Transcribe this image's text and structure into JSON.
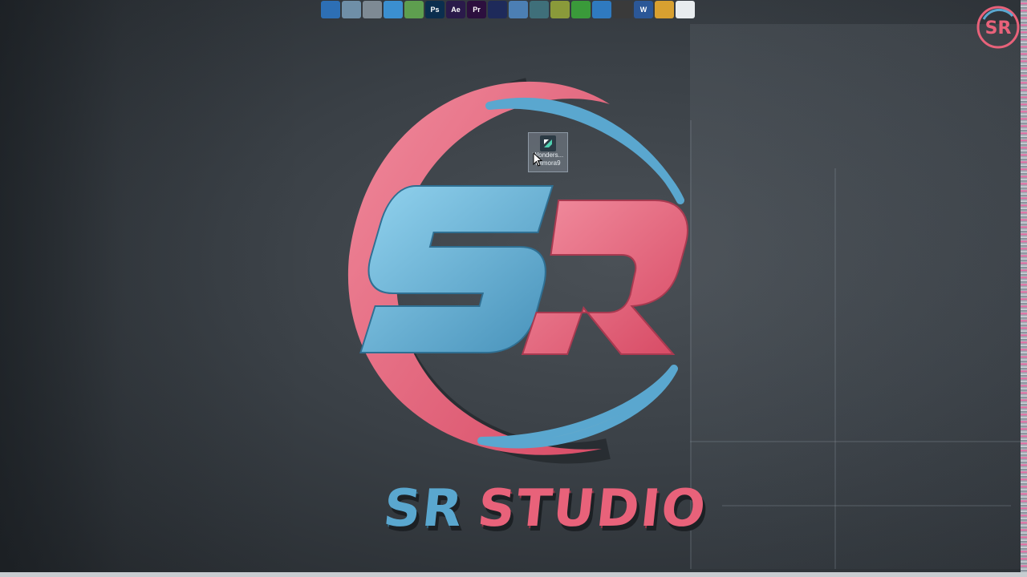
{
  "dock": {
    "icons": [
      {
        "name": "computer-icon",
        "label": "",
        "bg": "#2d6fb5"
      },
      {
        "name": "recycle-bin-icon",
        "label": "",
        "bg": "#6f8fa8"
      },
      {
        "name": "printer-icon",
        "label": "",
        "bg": "#7e8a94"
      },
      {
        "name": "browser-icon",
        "label": "",
        "bg": "#3b8fd0"
      },
      {
        "name": "network-icon",
        "label": "",
        "bg": "#5e9e4f"
      },
      {
        "name": "photoshop-icon",
        "label": "Ps",
        "bg": "#0b2e4e"
      },
      {
        "name": "after-effects-icon",
        "label": "Ae",
        "bg": "#2a1a4a"
      },
      {
        "name": "premiere-icon",
        "label": "Pr",
        "bg": "#2c0f3e"
      },
      {
        "name": "media-encoder-icon",
        "label": "",
        "bg": "#1e2a5a"
      },
      {
        "name": "app-circle-icon",
        "label": "",
        "bg": "#4c7fb4"
      },
      {
        "name": "settings-icon",
        "label": "",
        "bg": "#3f6f7a"
      },
      {
        "name": "cube-icon",
        "label": "",
        "bg": "#8a9a3a"
      },
      {
        "name": "green-app-icon",
        "label": "",
        "bg": "#3a9a3a"
      },
      {
        "name": "drive-icon",
        "label": "",
        "bg": "#2f7ac0"
      },
      {
        "name": "record-icon",
        "label": "",
        "bg": "#3a3a3a"
      },
      {
        "name": "word-icon",
        "label": "W",
        "bg": "#2b5797"
      },
      {
        "name": "windows-icon",
        "label": "",
        "bg": "#d8a030"
      },
      {
        "name": "document-icon",
        "label": "",
        "bg": "#e8ecef"
      }
    ]
  },
  "desktop_icon": {
    "label_line1": "Wonders...",
    "label_line2": "Filmora9"
  },
  "logo": {
    "monogram": "SR",
    "wordmark_part1": "SR",
    "wordmark_part2": "STUDIO"
  },
  "channel_badge": {
    "text": "SR"
  },
  "colors": {
    "brand_blue": "#5aa7cf",
    "brand_pink": "#e8627a",
    "wall": "#3a4046"
  }
}
